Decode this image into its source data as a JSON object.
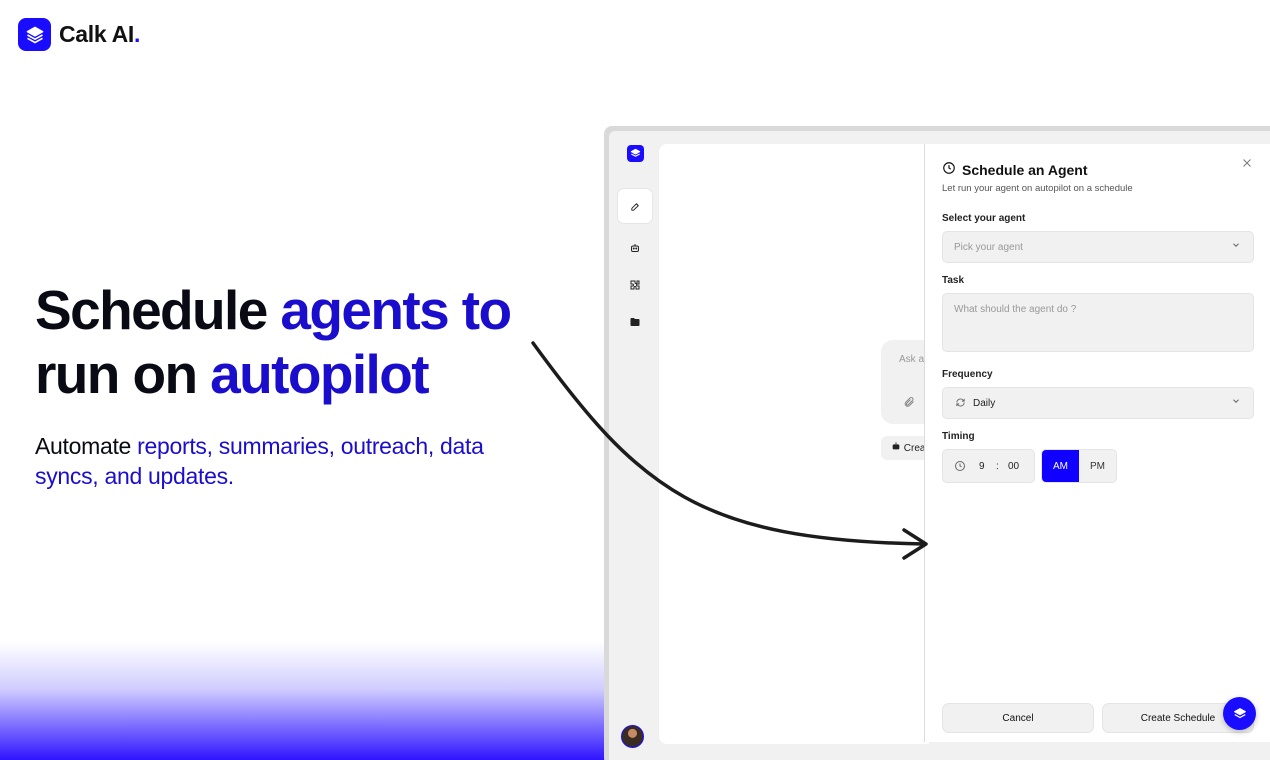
{
  "brand": {
    "name": "Calk AI",
    "dot": ".",
    "accent_color": "#1a0dff"
  },
  "hero": {
    "headline_plain_1": "Schedule ",
    "headline_accent_1": "agents to",
    "headline_plain_2": "run on ",
    "headline_accent_2": "autopilot",
    "sub_plain_1": "Automate ",
    "sub_accent_1": "reports, summaries, outreach, data",
    "sub_accent_2": "syncs, and updates."
  },
  "sidebar": {
    "icons": [
      "logo-icon",
      "new-chat-icon",
      "bot-icon",
      "puzzle-icon",
      "folder-icon"
    ]
  },
  "chat": {
    "input_placeholder": "Ask a",
    "create_chip": "Crea"
  },
  "panel": {
    "title": "Schedule an Agent",
    "subtitle": "Let run your agent on autopilot on a schedule",
    "agent_label": "Select your agent",
    "agent_placeholder": "Pick your agent",
    "task_label": "Task",
    "task_placeholder": "What should the agent do ?",
    "frequency_label": "Frequency",
    "frequency_value": "Daily",
    "timing_label": "Timing",
    "hour": "9",
    "colon": ":",
    "minute": "00",
    "am": "AM",
    "pm": "PM",
    "cancel": "Cancel",
    "create": "Create Schedule"
  }
}
